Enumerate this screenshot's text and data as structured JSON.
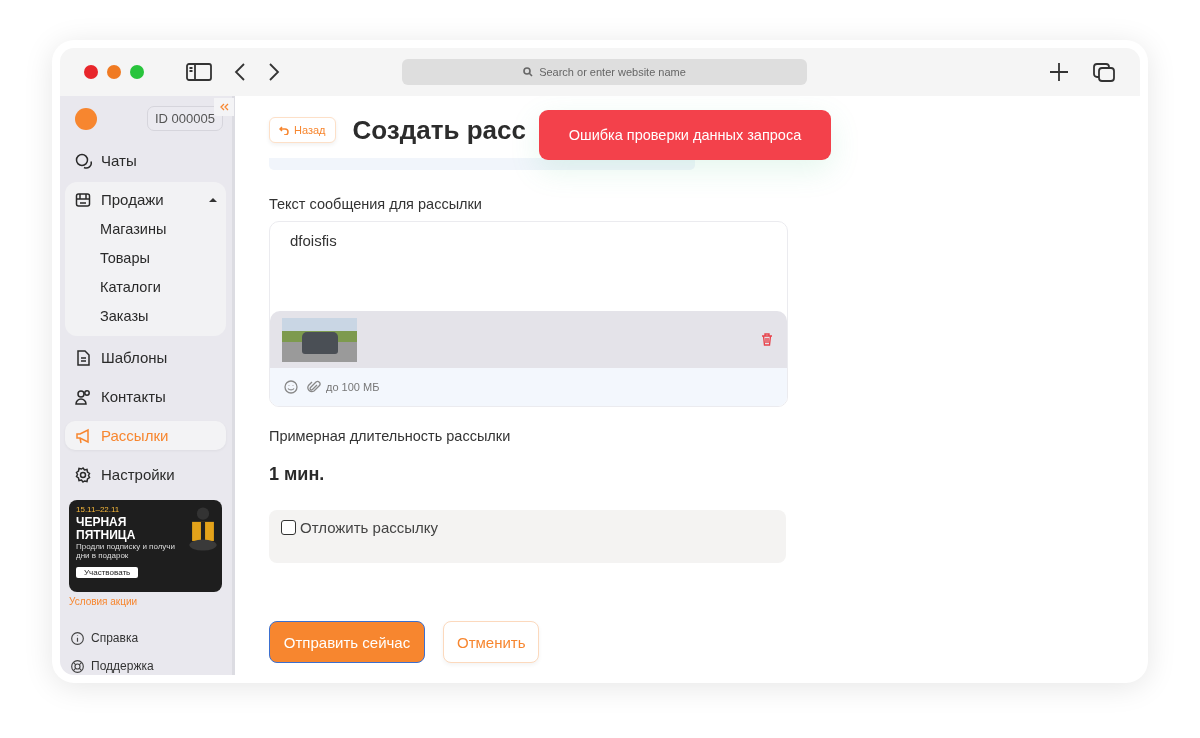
{
  "browser": {
    "address_placeholder": "Search or enter website name"
  },
  "sidebar": {
    "account_id": "ID 000005",
    "nav": [
      {
        "kind": "item",
        "label": "Чаты",
        "selected": false
      },
      {
        "kind": "group",
        "label": "Продажи",
        "selected": false,
        "expanded": true,
        "children": [
          {
            "label": "Магазины"
          },
          {
            "label": "Товары"
          },
          {
            "label": "Каталоги"
          },
          {
            "label": "Заказы"
          }
        ]
      },
      {
        "kind": "item",
        "label": "Шаблоны",
        "selected": false
      },
      {
        "kind": "item",
        "label": "Контакты",
        "selected": false
      },
      {
        "kind": "item",
        "label": "Рассылки",
        "selected": true
      },
      {
        "kind": "item",
        "label": "Настройки",
        "selected": false
      }
    ],
    "promo": {
      "dates": "15.11–22.11",
      "title": "ЧЕРНАЯ ПЯТНИЦА",
      "subtitle": "Продли подписку и получи дни в подарок",
      "button": "Участвовать"
    },
    "promo_link": "Условия акции",
    "footer": [
      {
        "label": "Справка"
      },
      {
        "label": "Поддержка"
      }
    ]
  },
  "page": {
    "back_button": "Назад",
    "title": "Создать расс",
    "toast": "Ошибка проверки данных запроса",
    "message_label": "Текст сообщения для рассылки",
    "message_value": "dfoisfis",
    "attachment_limit": "до 100 МБ",
    "duration_label": "Примерная длительность рассылки",
    "duration_value": "1 мин.",
    "delay": {
      "label": "Отложить рассылку",
      "checked": false
    },
    "buttons": [
      {
        "kind": "primary",
        "label": "Отправить сейчас"
      },
      {
        "kind": "secondary",
        "label": "Отменить"
      }
    ]
  }
}
